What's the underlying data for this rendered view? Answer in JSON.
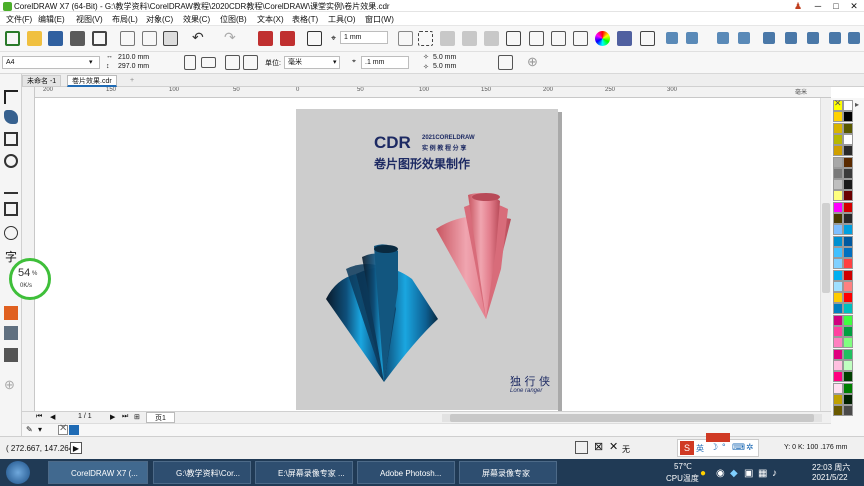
{
  "window": {
    "title": "CorelDRAW X7 (64-Bit) - G:\\教学资料\\CorelDRAW教程\\2020CDR教程\\CorelDRAW\\课堂实例\\卷片效果.cdr",
    "minimize": "─",
    "maximize": "□",
    "close": "✕",
    "user_icon": "person-icon"
  },
  "menu": {
    "items": [
      "文件(F)",
      "编辑(E)",
      "视图(V)",
      "布局(L)",
      "对象(C)",
      "效果(C)",
      "位图(B)",
      "文本(X)",
      "表格(T)",
      "工具(O)",
      "窗口(W)"
    ]
  },
  "toolbar": {
    "snap_value": "1 mm"
  },
  "propertybar": {
    "page_size": "A4",
    "width": "210.0 mm",
    "height": "297.0 mm",
    "units_label": "单位:",
    "units_value": "毫米",
    "nudge": ".1 mm",
    "dup_x": "5.0 mm",
    "dup_y": "5.0 mm"
  },
  "tabs": {
    "items": [
      {
        "label": "未命名 -1",
        "active": false
      },
      {
        "label": "卷片效果.cdr",
        "active": true
      }
    ],
    "add": "+"
  },
  "ruler": {
    "top_labels": [
      "200",
      "150",
      "100",
      "50",
      "0",
      "50",
      "100",
      "150",
      "200",
      "250",
      "300"
    ],
    "unit": "毫米"
  },
  "artwork": {
    "title_big": "CDR",
    "title_small_1": "2021CORELDRAW",
    "title_small_2": "实 例 教 程 分 享",
    "subtitle": "卷片图形效果制作",
    "sign_cn": "独 行 侠",
    "sign_en": "Lone ranger"
  },
  "perf_widget": {
    "percent": "54",
    "percent_unit": "%",
    "speed": "0K/s"
  },
  "pagenav": {
    "counter": "1 / 1",
    "page_tab": "页1"
  },
  "status": {
    "coords": "( 272.667, 147.264 )",
    "fill_label": "无",
    "color_readout": "Y: 0 K: 100  .176 mm"
  },
  "taskbar": {
    "items": [
      {
        "label": "CorelDRAW X7 (...",
        "color": "#4caf2a"
      },
      {
        "label": "G:\\教学资料\\Cor...",
        "color": "#e8c050"
      },
      {
        "label": "E:\\屏幕录像专家 ...",
        "color": "#e8c050"
      },
      {
        "label": "Adobe Photosh...",
        "color": "#1b2d4a"
      },
      {
        "label": "屏幕录像专家",
        "color": "#5f8fbf"
      }
    ],
    "temp": "57℃",
    "cpu": "CPU温度",
    "time": "22:03 周六",
    "date": "2021/5/22",
    "ime": "英"
  },
  "colors": {
    "accent": "#1f6bb5",
    "cone_blue": "#1a8fc9",
    "cone_red": "#e27c8a",
    "title_navy": "#1d2a63"
  },
  "palette": {
    "colors": [
      "#ffff00",
      "#ffffff",
      "#ffd200",
      "#000000",
      "#d8b400",
      "#5a5a00",
      "#b8b800",
      "#ffffff",
      "#d0a000",
      "#2a2a2a",
      "#a8a8a8",
      "#5a2a00",
      "#7a7a7a",
      "#3a3a3a",
      "#bfbfbf",
      "#1a1a1a",
      "#ffff7f",
      "#6a0000",
      "#ff00ff",
      "#d40000",
      "#4a3a00",
      "#2a2a2a",
      "#7fbfff",
      "#00a0e0",
      "#0090d0",
      "#005aa0",
      "#40c0ff",
      "#0070c0",
      "#80d0ff",
      "#ff4040",
      "#00b0f0",
      "#d00000",
      "#a0e0ff",
      "#ff8080",
      "#ffcc00",
      "#ff0000",
      "#0080c0",
      "#00c0c0",
      "#d0007f",
      "#40ff40",
      "#ff40a0",
      "#00a040",
      "#ff80c0",
      "#80ff80",
      "#e0007f",
      "#20c060",
      "#ffc0e0",
      "#c0ffc0",
      "#ff0080",
      "#004000",
      "#ffe0f0",
      "#008000",
      "#c0a000",
      "#002000",
      "#6a5a00",
      "#4a4a4a"
    ]
  }
}
